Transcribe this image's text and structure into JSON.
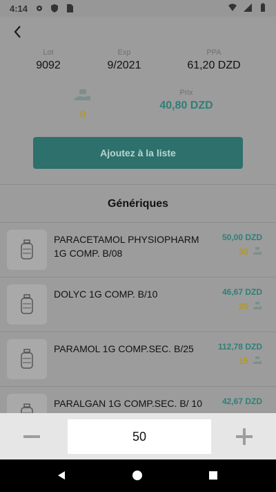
{
  "status_bar": {
    "time": "4:14",
    "left_icons": [
      "gear-icon",
      "shield-icon",
      "sim-card-icon"
    ],
    "right_icons": [
      "wifi-icon",
      "signal-icon",
      "battery-icon"
    ]
  },
  "header": {
    "back_icon": "back-arrow-icon"
  },
  "product_info": {
    "lot_label": "Lot",
    "lot_value": "9092",
    "exp_label": "Exp",
    "exp_value": "9/2021",
    "ppa_label": "PPA",
    "ppa_value": "61,20 DZD",
    "stock_icon": "hand-box-icon",
    "stock_value": "0",
    "prix_label": "Prix",
    "prix_value": "40,80 DZD"
  },
  "actions": {
    "add_label": "Ajoutez à la liste"
  },
  "generiques": {
    "title": "Génériques",
    "items": [
      {
        "name": "PARACETAMOL PHYSIOPHARM 1G COMP. B/08",
        "price": "50,00 DZD",
        "qty": "30"
      },
      {
        "name": "DOLYC 1G COMP. B/10",
        "price": "46,67 DZD",
        "qty": "20"
      },
      {
        "name": "PARAMOL 1G COMP.SEC. B/25",
        "price": "112,78 DZD",
        "qty": "15"
      },
      {
        "name": "PARALGAN 1G COMP.SEC. B/ 10",
        "price": "42,67 DZD",
        "qty": ""
      }
    ]
  },
  "quantity_bar": {
    "value": "50"
  },
  "colors": {
    "accent": "#2f7f78",
    "gold": "#b4972b",
    "overlay": "#9c9c9c"
  }
}
